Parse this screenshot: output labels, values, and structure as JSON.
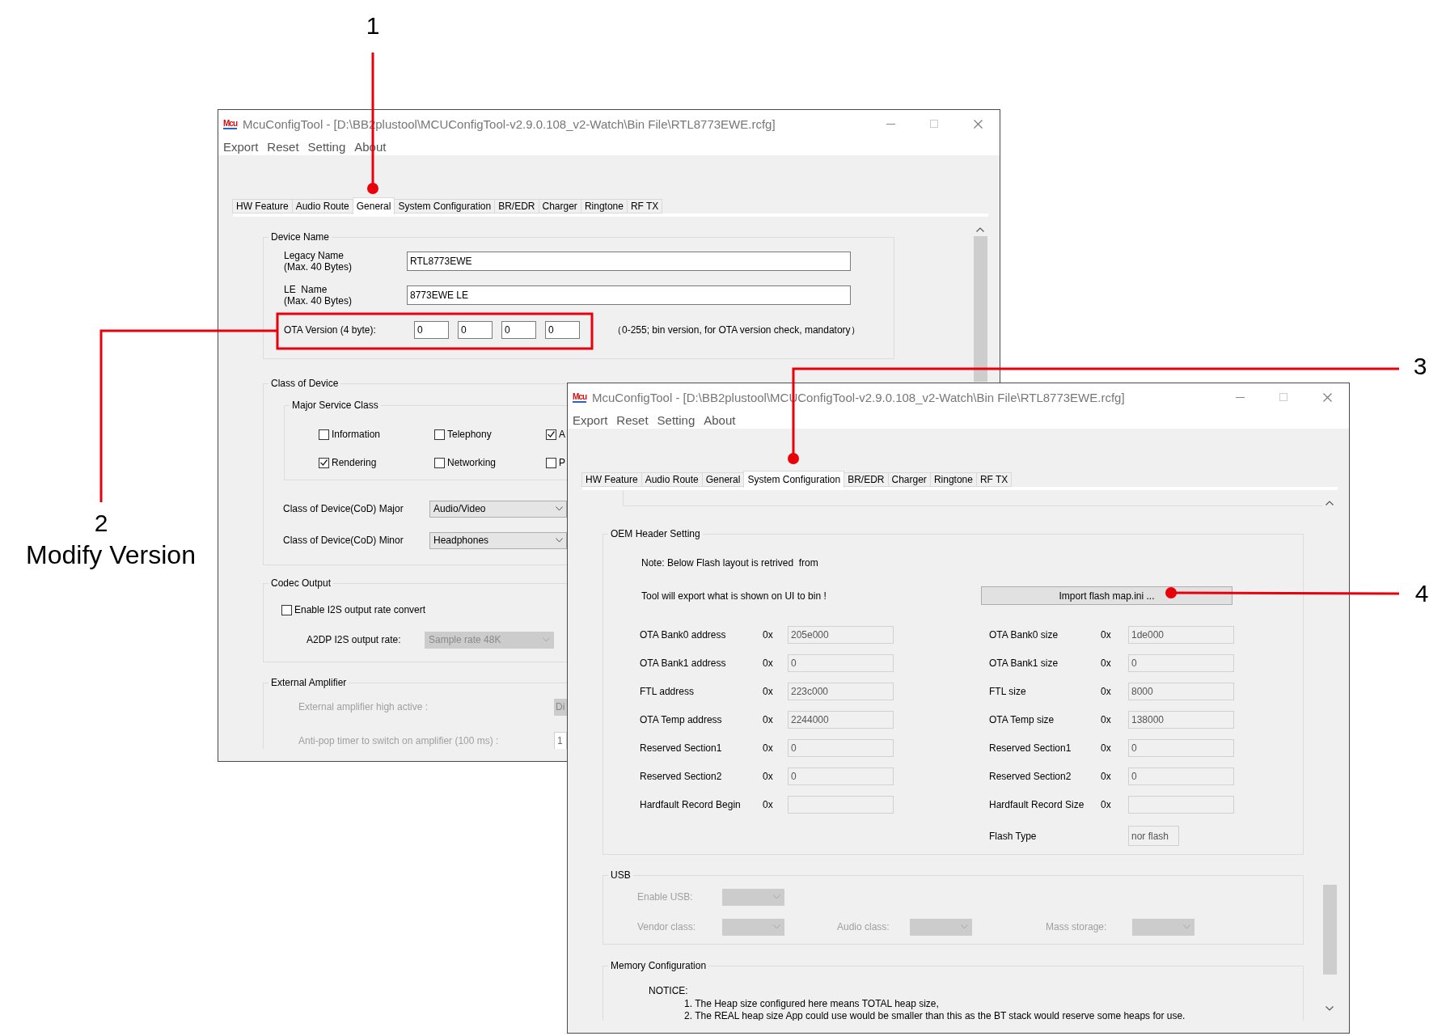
{
  "annotations": [
    {
      "label": "1"
    },
    {
      "label": "2",
      "caption": "Modify Version"
    },
    {
      "label": "3"
    },
    {
      "label": "4"
    }
  ],
  "general_window": {
    "logo": "Mcu",
    "title": "McuConfigTool - [D:\\BB2plustool\\MCUConfigTool-v2.9.0.108_v2-Watch\\Bin File\\RTL8773EWE.rcfg]",
    "menu": [
      "Export",
      "Reset",
      "Setting",
      "About"
    ],
    "tabs": [
      {
        "label": "HW Feature",
        "selected": false
      },
      {
        "label": "Audio Route",
        "selected": false
      },
      {
        "label": "General",
        "selected": true
      },
      {
        "label": "System Configuration",
        "selected": false
      },
      {
        "label": "BR/EDR",
        "selected": false
      },
      {
        "label": "Charger",
        "selected": false
      },
      {
        "label": "Ringtone",
        "selected": false
      },
      {
        "label": "RF TX",
        "selected": false
      }
    ],
    "device_name": {
      "title": "Device Name",
      "fields": [
        {
          "label": "Legacy Name\n(Max. 40 Bytes)",
          "value": "RTL8773EWE"
        },
        {
          "label": "LE  Name\n(Max. 40 Bytes)",
          "value": "8773EWE LE"
        }
      ],
      "ota_version": {
        "label": "OTA Version (4 byte):",
        "values": [
          "0",
          "0",
          "0",
          "0"
        ],
        "note": "（0-255; bin version, for OTA version check, mandatory）"
      }
    },
    "class_of_device": {
      "title": "Class of Device",
      "major_service_class": {
        "title": "Major Service Class",
        "options": [
          {
            "label": "Information",
            "checked": false
          },
          {
            "label": "Telephony",
            "checked": false
          },
          {
            "label": "A",
            "checked": true
          },
          {
            "label": "Rendering",
            "checked": true
          },
          {
            "label": "Networking",
            "checked": false
          },
          {
            "label": "P",
            "checked": false
          }
        ]
      },
      "selects": [
        {
          "label": "Class of Device(CoD) Major",
          "value": "Audio/Video"
        },
        {
          "label": "Class of Device(CoD) Minor",
          "value": "Headphones"
        }
      ]
    },
    "codec_output": {
      "title": "Codec Output",
      "checkbox": {
        "label": "Enable I2S output rate convert",
        "checked": false
      },
      "select": {
        "label": "A2DP I2S output rate:",
        "value": "Sample rate 48K",
        "disabled": true
      }
    },
    "external_amplifier": {
      "title": "External Amplifier",
      "disabled": true,
      "rows": [
        {
          "kind": "dropdown",
          "label": "External amplifier high active :",
          "value": "Di"
        },
        {
          "kind": "field",
          "label": "Anti-pop timer to switch on amplifier (100 ms) :",
          "value": "1"
        }
      ]
    }
  },
  "system_window": {
    "logo": "Mcu",
    "title": "McuConfigTool - [D:\\BB2plustool\\MCUConfigTool-v2.9.0.108_v2-Watch\\Bin File\\RTL8773EWE.rcfg]",
    "menu": [
      "Export",
      "Reset",
      "Setting",
      "About"
    ],
    "tabs": [
      {
        "label": "HW Feature",
        "selected": false
      },
      {
        "label": "Audio Route",
        "selected": false
      },
      {
        "label": "General",
        "selected": false
      },
      {
        "label": "System Configuration",
        "selected": true
      },
      {
        "label": "BR/EDR",
        "selected": false
      },
      {
        "label": "Charger",
        "selected": false
      },
      {
        "label": "Ringtone",
        "selected": false
      },
      {
        "label": "RF TX",
        "selected": false
      }
    ],
    "oem_header": {
      "title": "OEM Header Setting",
      "note": "Note: Below Flash layout is retrived  from",
      "export_note": "Tool will export what is shown on UI to bin !",
      "import_button": "Import flash map.ini ...",
      "rows": [
        {
          "left_label": "OTA Bank0 address",
          "left_prefix": "0x",
          "left_value": "205e000",
          "right_label": "OTA Bank0 size",
          "right_prefix": "0x",
          "right_value": "1de000"
        },
        {
          "left_label": "OTA Bank1 address",
          "left_prefix": "0x",
          "left_value": "0",
          "right_label": "OTA Bank1 size",
          "right_prefix": "0x",
          "right_value": "0"
        },
        {
          "left_label": "FTL address",
          "left_prefix": "0x",
          "left_value": "223c000",
          "right_label": "FTL size",
          "right_prefix": "0x",
          "right_value": "8000"
        },
        {
          "left_label": "OTA Temp address",
          "left_prefix": "0x",
          "left_value": "2244000",
          "right_label": "OTA Temp size",
          "right_prefix": "0x",
          "right_value": "138000"
        },
        {
          "left_label": "Reserved Section1",
          "left_prefix": "0x",
          "left_value": "0",
          "right_label": "Reserved Section1",
          "right_prefix": "0x",
          "right_value": "0"
        },
        {
          "left_label": "Reserved Section2",
          "left_prefix": "0x",
          "left_value": "0",
          "right_label": "Reserved Section2",
          "right_prefix": "0x",
          "right_value": "0"
        },
        {
          "left_label": "Hardfault Record Begin",
          "left_prefix": "0x",
          "right_label": "Hardfault Record Size",
          "right_prefix": "0x"
        }
      ],
      "flash_type": {
        "label": "Flash Type",
        "value": "nor flash"
      }
    },
    "usb": {
      "title": "USB",
      "disabled": true,
      "fields": [
        {
          "label": "Enable USB:"
        },
        {
          "label": "Vendor class:"
        },
        {
          "label": "Audio class:"
        },
        {
          "label": "Mass storage:"
        }
      ]
    },
    "memory_configuration": {
      "title": "Memory Configuration",
      "notice": "NOTICE:",
      "lines": [
        "1. The Heap size configured here means TOTAL heap size,",
        "2. The REAL heap size App could use would be smaller than this as the BT stack would reserve some heaps for use."
      ]
    }
  }
}
